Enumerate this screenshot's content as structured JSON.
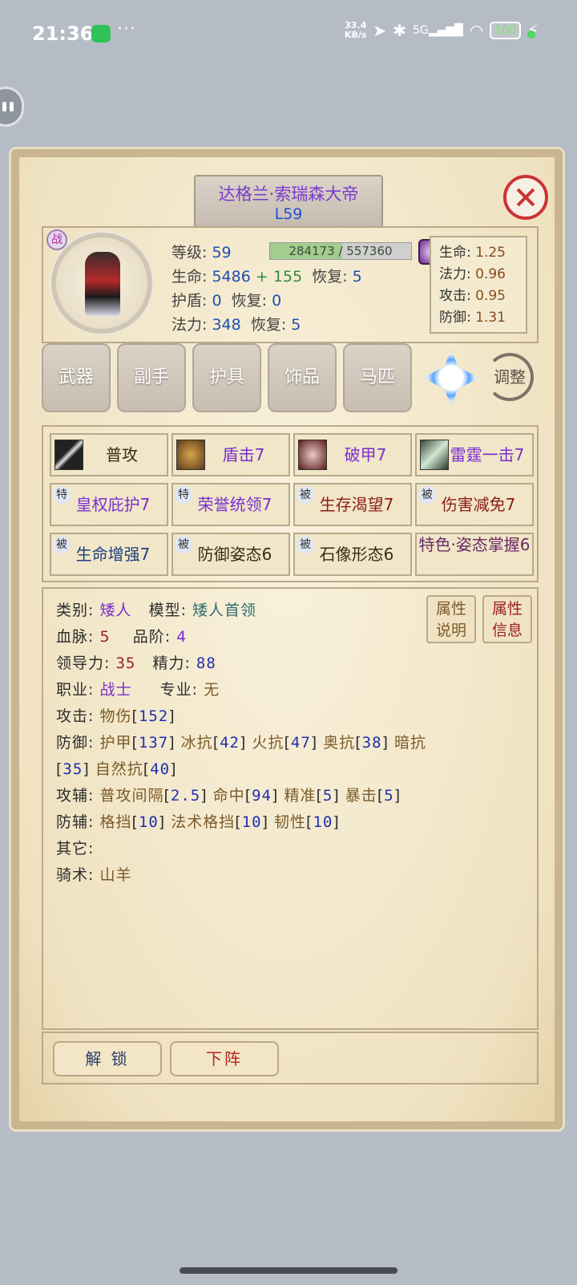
{
  "status_bar": {
    "time": "21:36",
    "more": "···",
    "net_speed": "33.4\nKB/s",
    "signal": "5G",
    "battery": "100"
  },
  "character": {
    "name": "达格兰·索瑞森大帝",
    "level_label": "L59",
    "badge": "战",
    "level_key": "等级:",
    "level_val": "59",
    "exp_text": "284173 / 557360",
    "exp_fraction": 0.51,
    "hp_key": "生命:",
    "hp_val": "5486",
    "hp_plus": "+ 155",
    "hp_regen_key": "恢复:",
    "hp_regen_val": "5",
    "shield_key": "护盾:",
    "shield_val": "0",
    "shield_regen_key": "恢复:",
    "shield_regen_val": "0",
    "mp_key": "法力:",
    "mp_val": "348",
    "mp_regen_key": "恢复:",
    "mp_regen_val": "5"
  },
  "multipliers": [
    {
      "label": "生命:",
      "value": "1.25"
    },
    {
      "label": "法力:",
      "value": "0.96"
    },
    {
      "label": "攻击:",
      "value": "0.95"
    },
    {
      "label": "防御:",
      "value": "1.31"
    }
  ],
  "equip_tabs": [
    "武器",
    "副手",
    "护具",
    "饰品",
    "马匹"
  ],
  "adjust_label": "调整",
  "skills": [
    {
      "name": "普攻",
      "tag": ""
    },
    {
      "name": "盾击7",
      "tag": ""
    },
    {
      "name": "破甲7",
      "tag": ""
    },
    {
      "name": "雷霆一击7",
      "tag": ""
    },
    {
      "name": "皇权庇护7",
      "tag": "特"
    },
    {
      "name": "荣誉统领7",
      "tag": "特"
    },
    {
      "name": "生存渴望7",
      "tag": "被"
    },
    {
      "name": "伤害减免7",
      "tag": "被"
    },
    {
      "name": "生命增强7",
      "tag": "被"
    },
    {
      "name": "防御姿态6",
      "tag": "被"
    },
    {
      "name": "石像形态6",
      "tag": "被"
    },
    {
      "name": "特色·姿态掌握6",
      "tag": ""
    }
  ],
  "details": {
    "category_key": "类别:",
    "category_val": "矮人",
    "model_key": "模型:",
    "model_val": "矮人首领",
    "blood_key": "血脉:",
    "blood_val": "5",
    "grade_key": "品阶:",
    "grade_val": "4",
    "leadership_key": "领导力:",
    "leadership_val": "35",
    "energy_key": "精力:",
    "energy_val": "88",
    "job_key": "职业:",
    "job_val": "战士",
    "spec_key": "专业:",
    "spec_val": "无",
    "attack_key": "攻击:",
    "attack_text": "物伤",
    "attack_val": "152",
    "defense_key": "防御:",
    "defense_items": [
      {
        "name": "护甲",
        "val": "137"
      },
      {
        "name": "冰抗",
        "val": "42"
      },
      {
        "name": "火抗",
        "val": "47"
      },
      {
        "name": "奥抗",
        "val": "38"
      },
      {
        "name": "暗抗",
        "val": "35"
      },
      {
        "name": "自然抗",
        "val": "40"
      }
    ],
    "atk_aux_key": "攻辅:",
    "atk_aux_items": [
      {
        "name": "普攻间隔",
        "val": "2.5"
      },
      {
        "name": "命中",
        "val": "94"
      },
      {
        "name": "精准",
        "val": "5"
      },
      {
        "name": "暴击",
        "val": "5"
      }
    ],
    "def_aux_key": "防辅:",
    "def_aux_items": [
      {
        "name": "格挡",
        "val": "10"
      },
      {
        "name": "法术格挡",
        "val": "10"
      },
      {
        "name": "韧性",
        "val": "10"
      }
    ],
    "other_key": "其它:",
    "riding_key": "骑术:",
    "riding_val": "山羊"
  },
  "attr_buttons": {
    "explain_line1": "属性",
    "explain_line2": "说明",
    "info_line1": "属性",
    "info_line2": "信息"
  },
  "bottom_buttons": {
    "unlock": "解 锁",
    "dismiss": "下阵"
  },
  "colors": {
    "accent_purple": "#7a2fd0",
    "close_red": "#cc3333",
    "parchment": "#f4e9c8"
  }
}
